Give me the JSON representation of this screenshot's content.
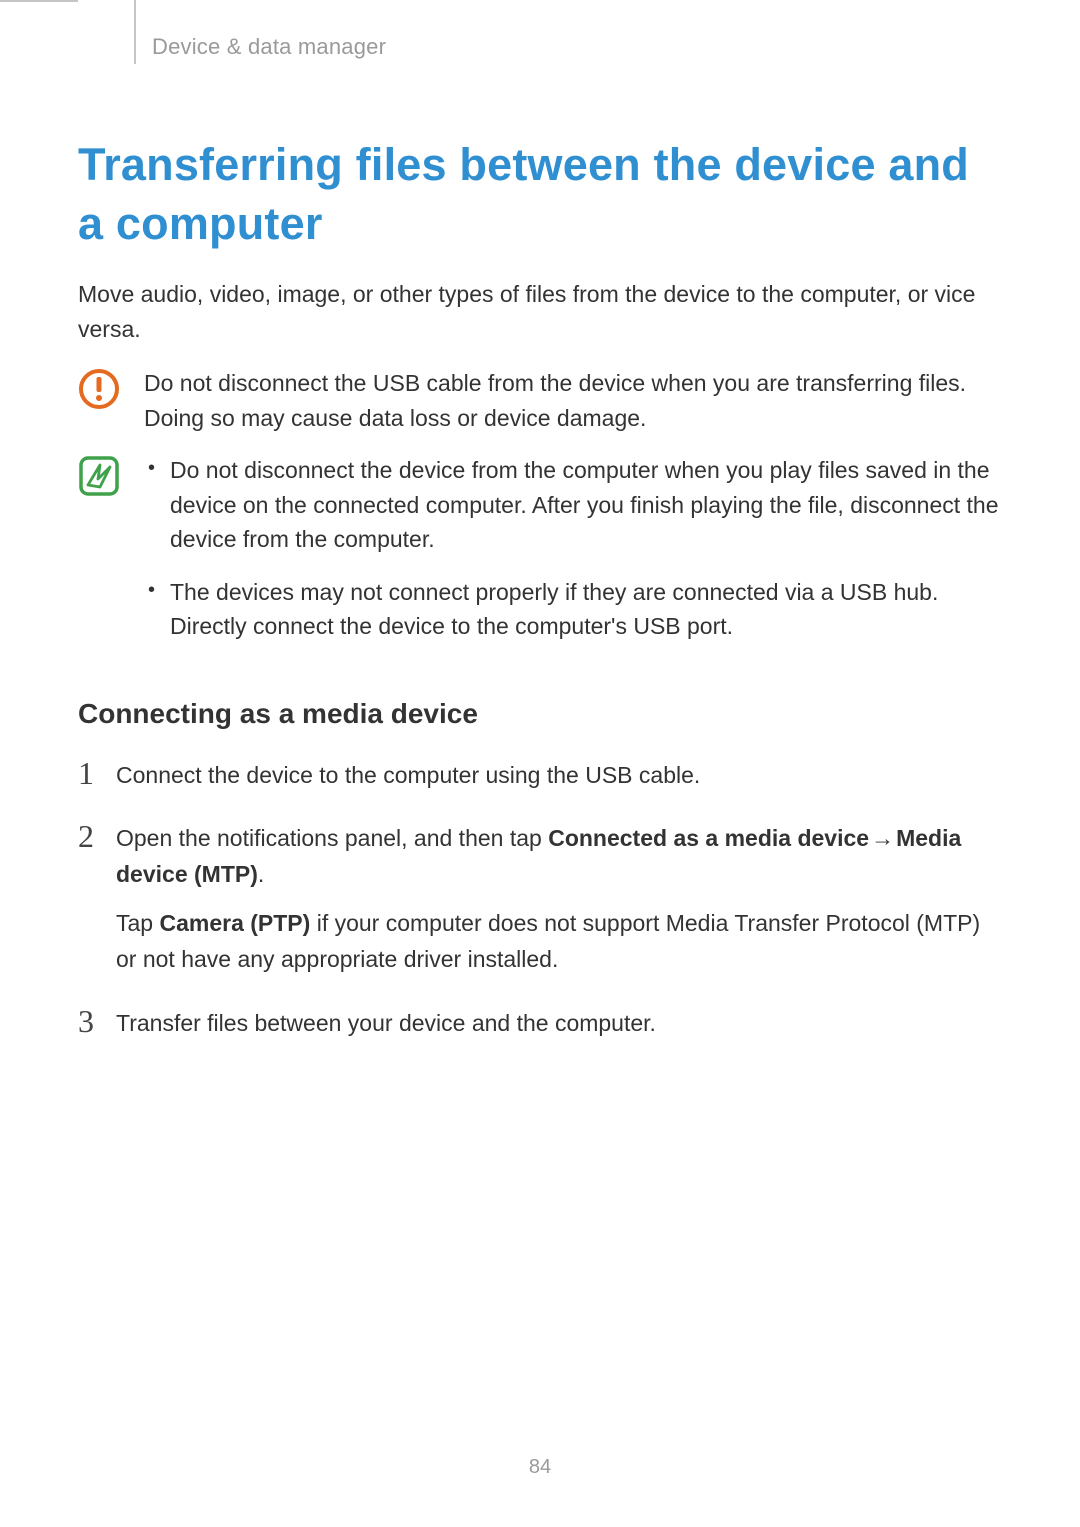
{
  "breadcrumb": "Device & data manager",
  "title": "Transferring files between the device and a computer",
  "intro": "Move audio, video, image, or other types of files from the device to the computer, or vice versa.",
  "warning_text": "Do not disconnect the USB cable from the device when you are transferring files. Doing so may cause data loss or device damage.",
  "note_bullets": [
    "Do not disconnect the device from the computer when you play files saved in the device on the connected computer. After you finish playing the file, disconnect the device from the computer.",
    "The devices may not connect properly if they are connected via a USB hub. Directly connect the device to the computer's USB port."
  ],
  "subheading": "Connecting as a media device",
  "steps": {
    "s1": {
      "num": "1",
      "text": "Connect the device to the computer using the USB cable."
    },
    "s2": {
      "num": "2",
      "pre": "Open the notifications panel, and then tap ",
      "bold1": "Connected as a media device",
      "arrow": " → ",
      "bold2": "Media device (MTP)",
      "post": ".",
      "para2_pre": "Tap ",
      "para2_bold": "Camera (PTP)",
      "para2_post": " if your computer does not support Media Transfer Protocol (MTP) or not have any appropriate driver installed."
    },
    "s3": {
      "num": "3",
      "text": "Transfer files between your device and the computer."
    }
  },
  "page_number": "84"
}
